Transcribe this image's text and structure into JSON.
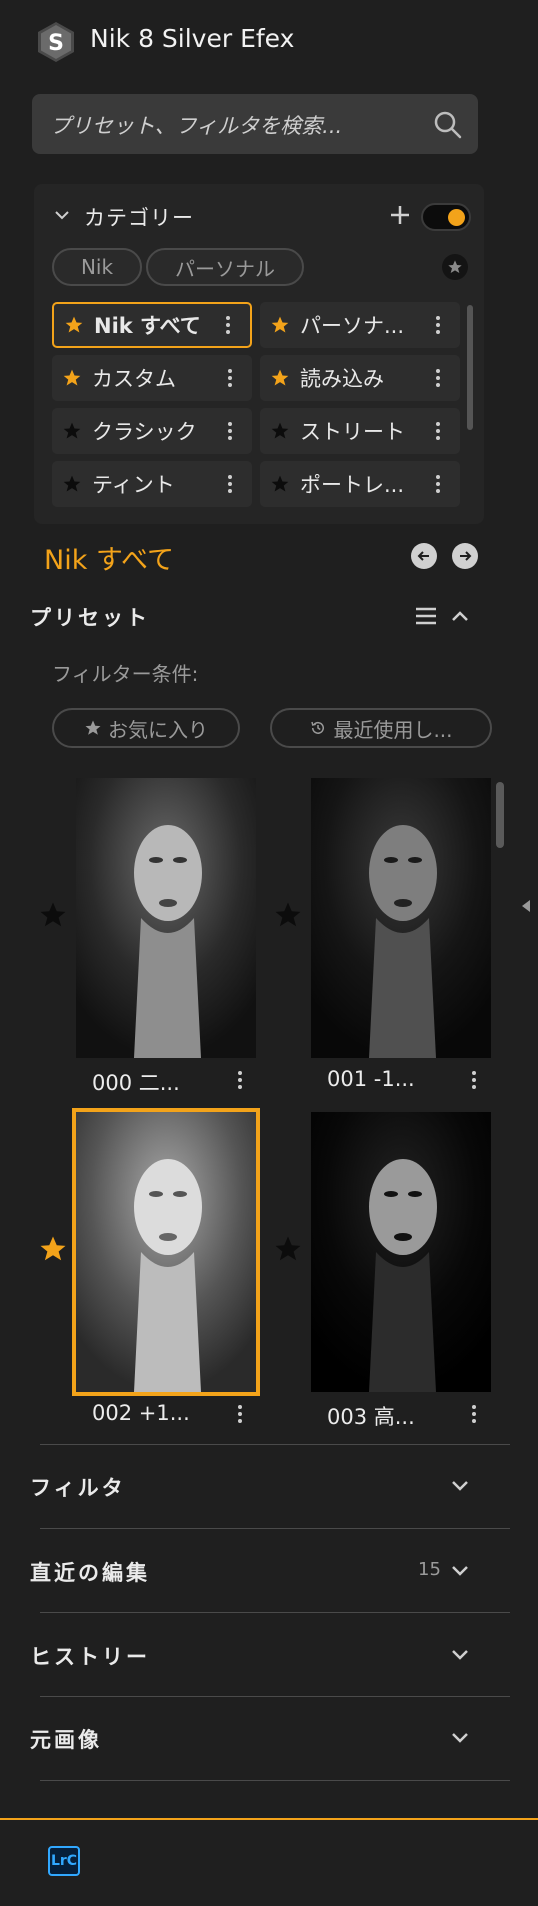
{
  "header": {
    "title": "Nik 8 Silver Efex",
    "logo_letter": "S"
  },
  "search": {
    "placeholder": "プリセット、フィルタを検索..."
  },
  "categories": {
    "title": "カテゴリー",
    "toggle_on": true,
    "pills": [
      "Nik",
      "パーソナル"
    ],
    "items": [
      {
        "label": "Nik すべて",
        "starred": true,
        "active": true
      },
      {
        "label": "パーソナ...",
        "starred": true,
        "active": false
      },
      {
        "label": "カスタム",
        "starred": true,
        "active": false
      },
      {
        "label": "読み込み",
        "starred": true,
        "active": false
      },
      {
        "label": "クラシック",
        "starred": false,
        "active": false
      },
      {
        "label": "ストリート",
        "starred": false,
        "active": false
      },
      {
        "label": "ティント",
        "starred": false,
        "active": false
      },
      {
        "label": "ポートレ...",
        "starred": false,
        "active": false
      }
    ]
  },
  "current_category": "Nik すべて",
  "presets": {
    "title": "プリセット",
    "filter_label": "フィルター条件:",
    "chips": {
      "favorites": "お気に入り",
      "recent": "最近使用し..."
    },
    "items": [
      {
        "label": "000 二...",
        "starred": false,
        "selected": false
      },
      {
        "label": "001 -1...",
        "starred": false,
        "selected": false
      },
      {
        "label": "002 +1...",
        "starred": true,
        "selected": true
      },
      {
        "label": "003 高...",
        "starred": false,
        "selected": false
      }
    ]
  },
  "sections": [
    {
      "title": "フィルタ",
      "count": ""
    },
    {
      "title": "直近の編集",
      "count": "15"
    },
    {
      "title": "ヒストリー",
      "count": ""
    },
    {
      "title": "元画像",
      "count": ""
    }
  ],
  "footer": {
    "lrc_label": "LrC"
  },
  "colors": {
    "accent": "#f3a31a",
    "background": "#1f1f1f",
    "panel": "#252525"
  }
}
